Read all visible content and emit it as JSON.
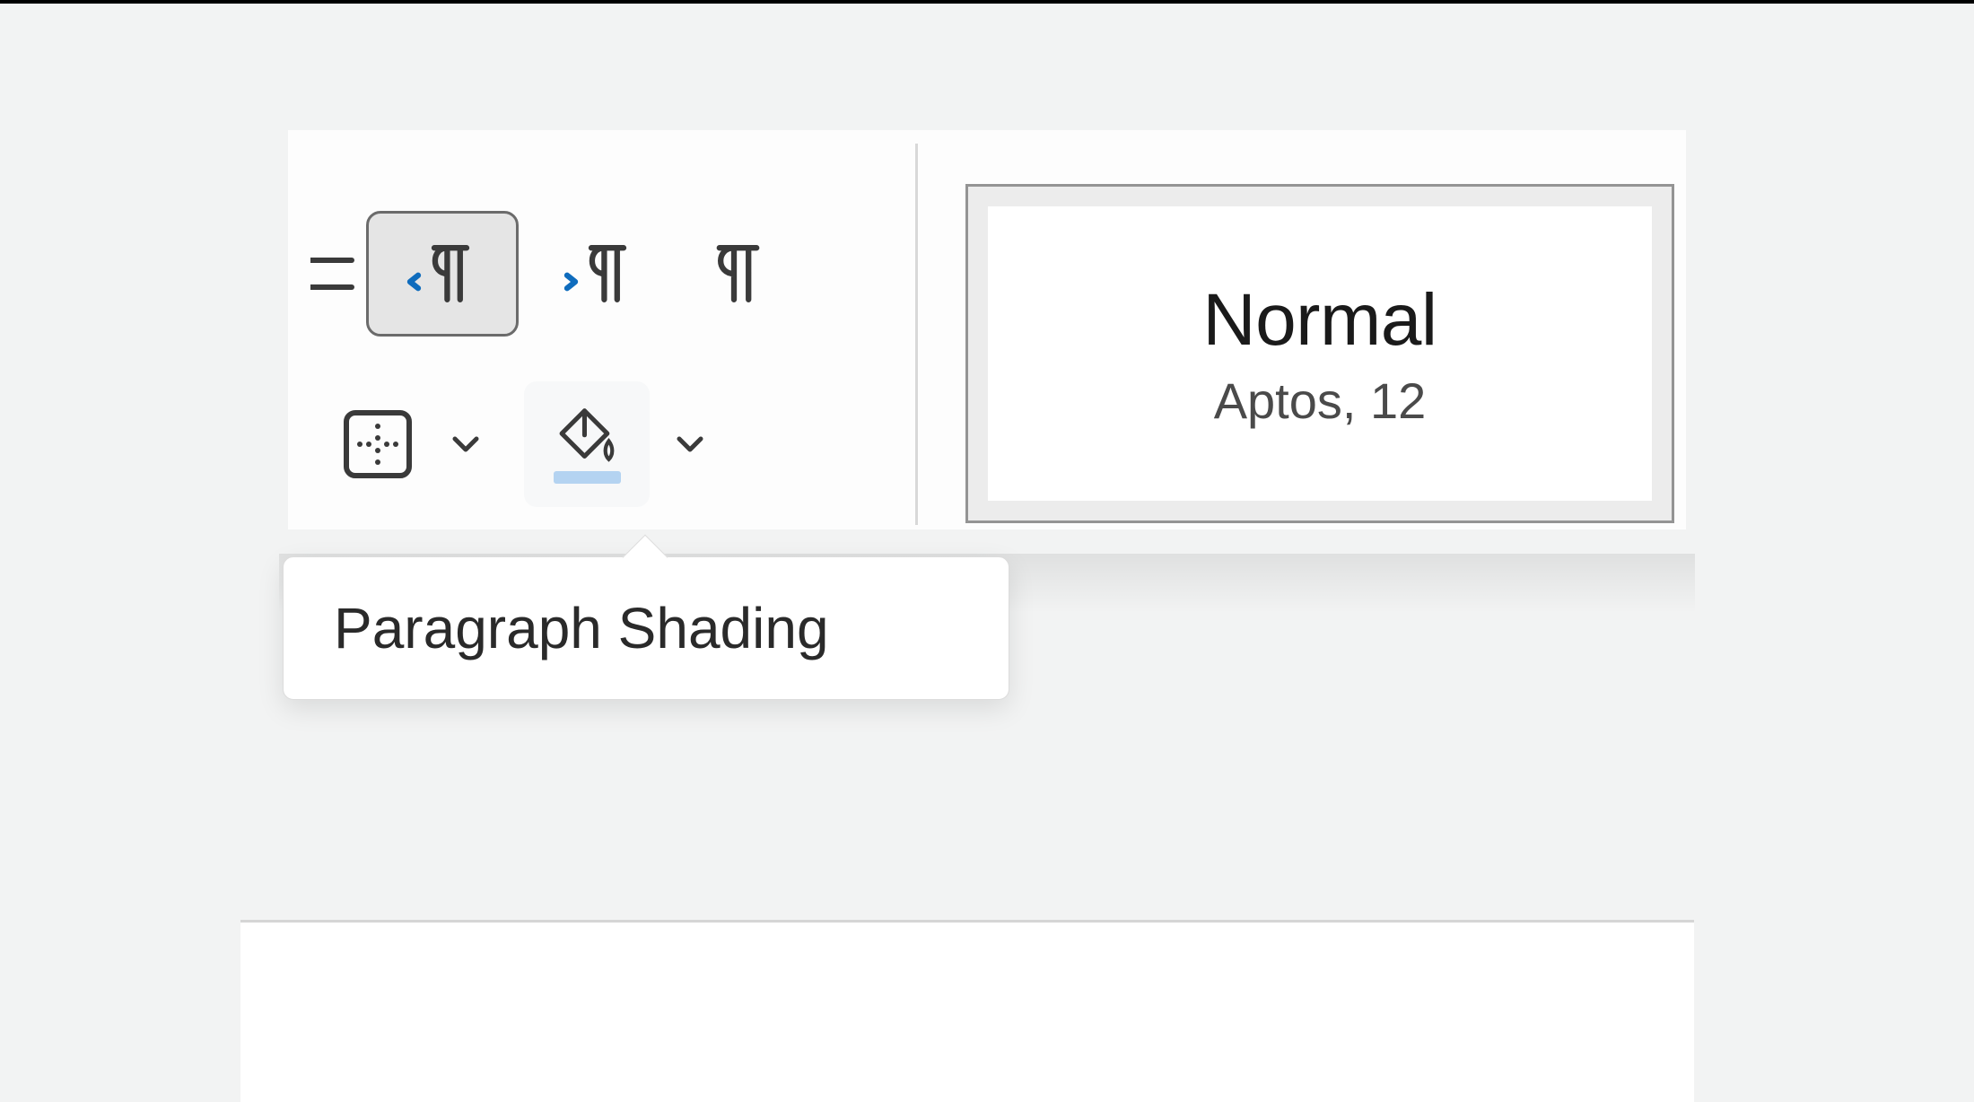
{
  "tooltip": {
    "text": "Paragraph Shading"
  },
  "style": {
    "name": "Normal",
    "font_description": "Aptos, 12"
  },
  "icons": {
    "list": "list-icon",
    "ltr": "left-to-right-pilcrow",
    "rtl": "right-to-left-pilcrow",
    "pilcrow": "pilcrow-icon",
    "borders": "borders-icon",
    "shading": "shading-paint-bucket-icon"
  }
}
